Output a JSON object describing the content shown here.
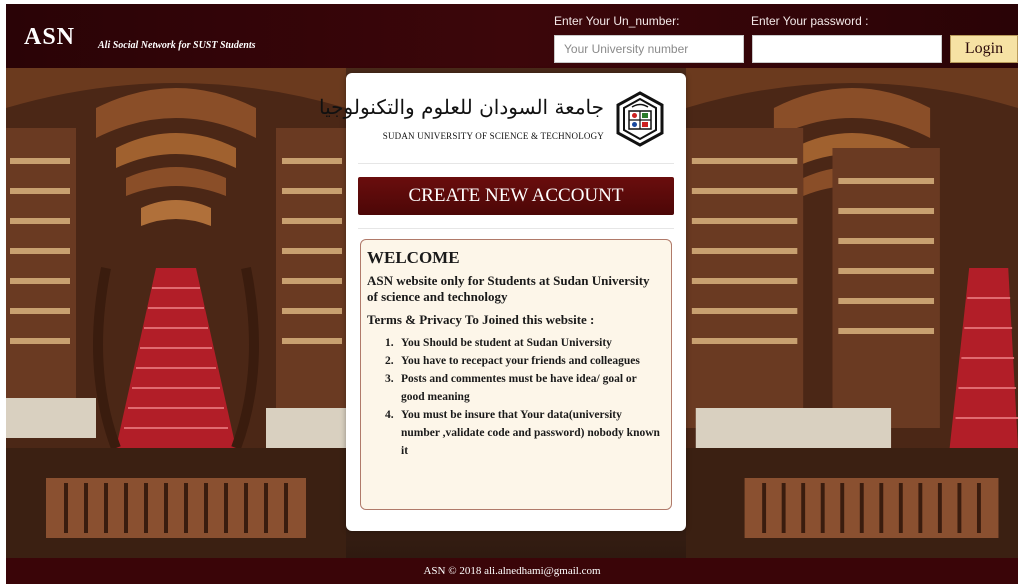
{
  "header": {
    "brand": "ASN",
    "tagline": "Ali Social Network for SUST Students",
    "username_label": "Enter Your Un_number:",
    "username_placeholder": "Your University number",
    "username_value": "",
    "password_label": "Enter Your password :",
    "password_placeholder": "",
    "password_value": "",
    "login_label": "Login"
  },
  "card": {
    "university_arabic": "جامعة السودان للعلوم والتكنولوجيا",
    "university_english": "SUDAN UNIVERSITY OF SCIENCE & TECHNOLOGY",
    "create_button_label": "CREATE NEW ACCOUNT",
    "welcome": {
      "title": "WELCOME",
      "intro": "ASN website only for Students at Sudan University of science and technology",
      "terms_heading": "Terms & Privacy To Joined this website :",
      "items": [
        {
          "num": "1.",
          "text": "You Should be student at Sudan University"
        },
        {
          "num": "2.",
          "text": "You have to recepact your friends and colleagues"
        },
        {
          "num": "3.",
          "text": "Posts and commentes must be have idea/ goal or good meaning"
        },
        {
          "num": "4.",
          "text": "You must be insure that Your data(university number ,validate code and password) nobody known it"
        }
      ]
    }
  },
  "footer": {
    "text": "ASN © 2018 ali.alnedhami@gmail.com"
  },
  "colors": {
    "header_bg": "#3c060a",
    "create_button_bg": "#5a0a0a",
    "login_button_bg": "#f6e2a4",
    "welcome_box_bg": "#fdf6e9",
    "footer_bg": "#3a0508"
  },
  "icons": {
    "university_seal": "sust-seal-icon",
    "background": "library-staircase-photo"
  }
}
